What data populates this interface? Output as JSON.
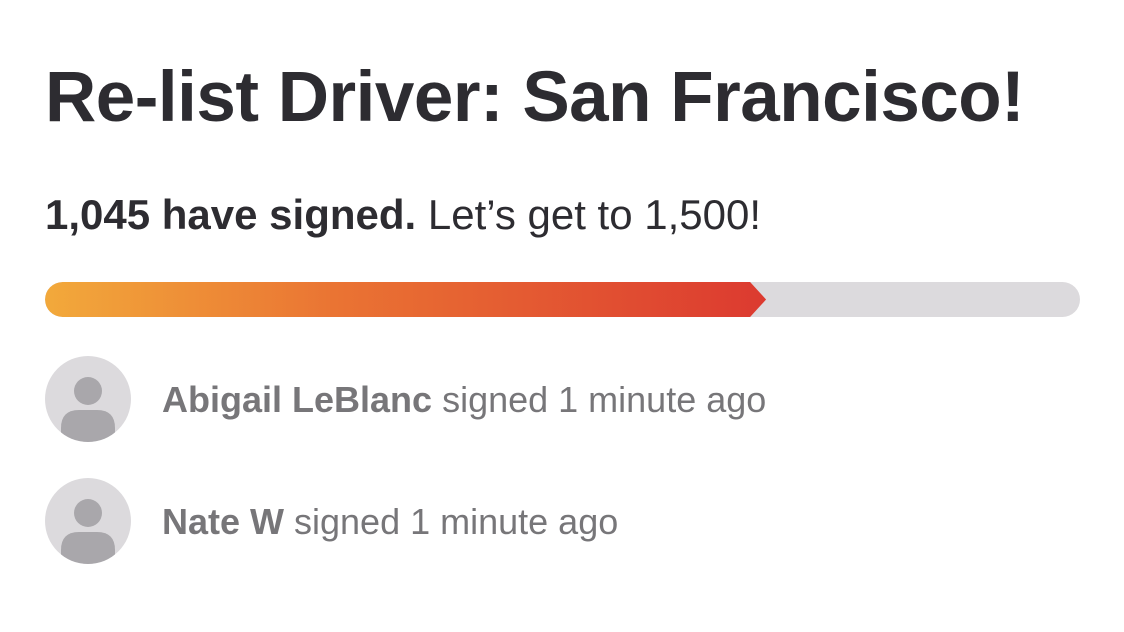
{
  "petition": {
    "title": "Re-list Driver: San Francisco!",
    "signed_count_text": "1,045 have signed.",
    "goal_text": " Let’s get to 1,500!",
    "signed": 1045,
    "goal": 1500,
    "progress_fraction": 0.6967
  },
  "colors": {
    "progress_start": "#f2a93b",
    "progress_end": "#dc3a30",
    "track": "#dcdadd",
    "text": "#2d2c31",
    "muted_text": "#777679"
  },
  "signers": [
    {
      "name": "Abigail LeBlanc",
      "action": " signed 1 minute ago",
      "icon": "user-avatar-icon"
    },
    {
      "name": "Nate W",
      "action": " signed 1 minute ago",
      "icon": "user-avatar-icon"
    }
  ]
}
